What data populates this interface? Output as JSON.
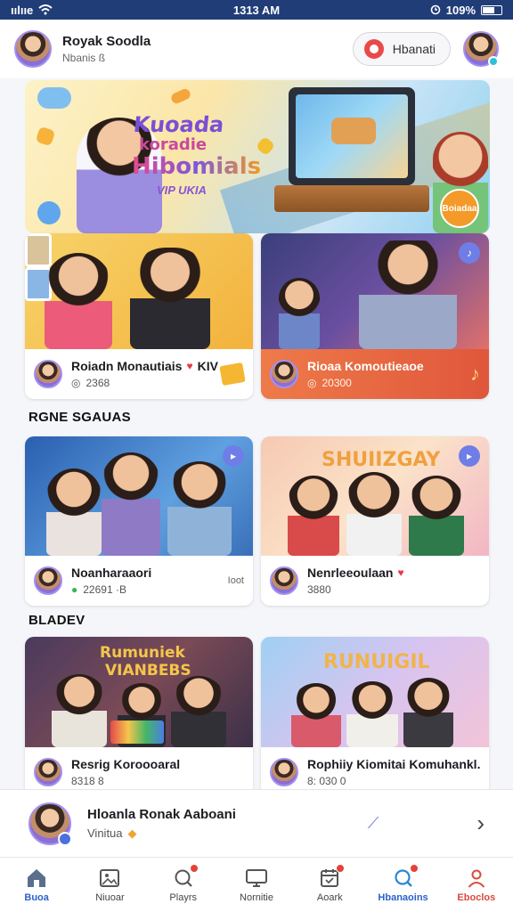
{
  "status_bar": {
    "carrier": "ıılııe",
    "time": "1313 AM",
    "battery": "109%"
  },
  "header": {
    "title": "Royak Soodla",
    "subtitle": "Nbanis ß",
    "action_label": "Hbanati"
  },
  "hero": {
    "line1": "Kuoada",
    "line2": "koradie",
    "line3": "Hibomials",
    "line4": "VIP UKIA",
    "badge": "Boiadaa"
  },
  "top_cards": [
    {
      "title": "Roiadn Monautiais",
      "tag": "KIV",
      "meta": "2368"
    },
    {
      "title": "Rioaa Komoutieaoe",
      "meta": "20300"
    }
  ],
  "section1": {
    "title": "RGNE SGAUAS"
  },
  "mid_cards": [
    {
      "title": "Noanharaaori",
      "meta": "22691 ·B",
      "extra": "Ioot"
    },
    {
      "title": "Nenrleeoulaan",
      "meta": "3880",
      "banner": "SHUIIZGAY"
    }
  ],
  "section2": {
    "title": "BLADEV"
  },
  "bottom_cards": [
    {
      "title": "Resrig Koroooaral",
      "meta": "8318 8",
      "banner_line1": "Rumuniek",
      "banner_line2": "VIANBEBS"
    },
    {
      "title": "Rophiiy Kiomitai Komuhankl.",
      "meta": "8: 030 0",
      "banner": "RUNUIGIL"
    }
  ],
  "now_playing": {
    "title": "Hloanla Ronak Aaboani",
    "subtitle": "Vinitua"
  },
  "nav": [
    {
      "label": "Buoa",
      "icon": "home-icon",
      "state": "active"
    },
    {
      "label": "Niuoar",
      "icon": "photo-icon"
    },
    {
      "label": "Playrs",
      "icon": "search-record-icon",
      "dot": true
    },
    {
      "label": "Nornitie",
      "icon": "monitor-icon"
    },
    {
      "label": "Aoark",
      "icon": "calendar-icon",
      "dot": true
    },
    {
      "label": "Hbanaoins",
      "icon": "search-icon",
      "dot": true,
      "state": "active"
    },
    {
      "label": "Eboclos",
      "icon": "profile-icon",
      "state": "hot"
    }
  ]
}
